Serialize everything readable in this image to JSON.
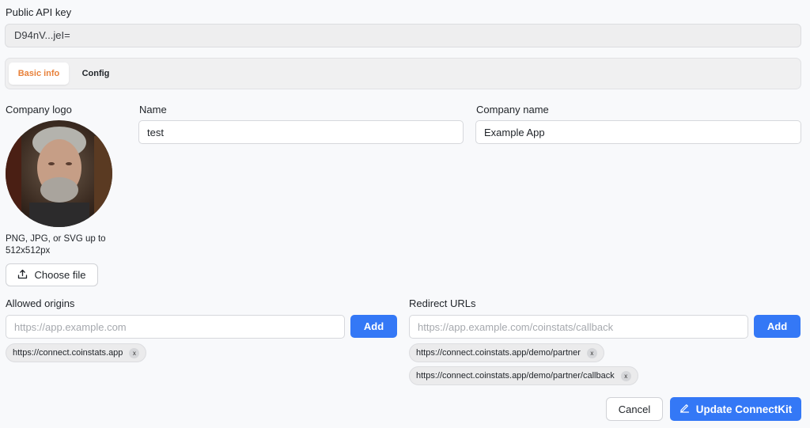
{
  "api_key": {
    "label": "Public API key",
    "value": "D94nV...jeI="
  },
  "tabs": [
    {
      "label": "Basic info",
      "active": true
    },
    {
      "label": "Config",
      "active": false
    }
  ],
  "company_logo": {
    "label": "Company logo",
    "hint": "PNG, JPG, or SVG up to 512x512px",
    "choose_file_label": "Choose file"
  },
  "name": {
    "label": "Name",
    "value": "test"
  },
  "company_name": {
    "label": "Company name",
    "value": "Example App"
  },
  "allowed_origins": {
    "label": "Allowed origins",
    "placeholder": "https://app.example.com",
    "add_label": "Add",
    "chips": [
      "https://connect.coinstats.app"
    ]
  },
  "redirect_urls": {
    "label": "Redirect URLs",
    "placeholder": "https://app.example.com/coinstats/callback",
    "add_label": "Add",
    "chips": [
      "https://connect.coinstats.app/demo/partner",
      "https://connect.coinstats.app/demo/partner/callback"
    ]
  },
  "chip_remove_label": "x",
  "footer": {
    "cancel_label": "Cancel",
    "update_label": "Update ConnectKit"
  },
  "colors": {
    "accent_blue": "#3478f6",
    "active_tab_orange": "#e8813a"
  },
  "icons": {
    "upload": "upload-icon",
    "edit": "pencil-icon"
  }
}
